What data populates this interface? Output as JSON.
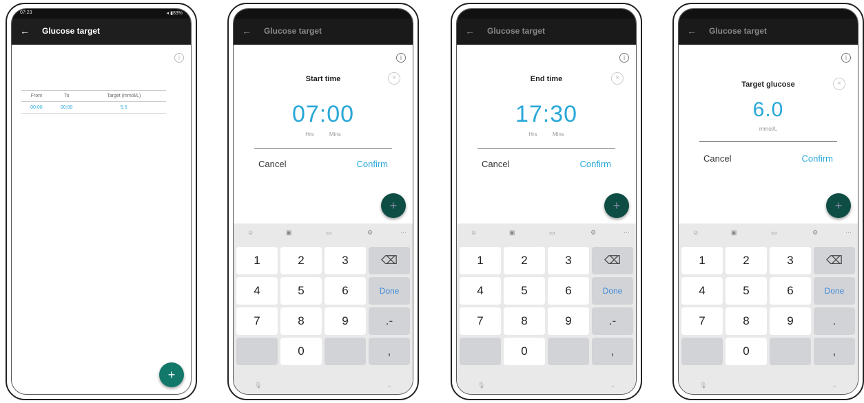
{
  "screen1": {
    "status_time": "07:23",
    "status_right": "◂ ▮83%",
    "title": "Glucose target",
    "back": "←",
    "info": "i",
    "columns": [
      "From",
      "To",
      "Target (mmol/L)"
    ],
    "rows": [
      {
        "from": "00:00",
        "to": "00:00",
        "target": "5.5"
      }
    ],
    "fab": "+"
  },
  "dialogs": [
    {
      "title": "Start time",
      "value": "07:00",
      "units": [
        "Hrs",
        "Mins"
      ],
      "cancel": "Cancel",
      "confirm": "Confirm"
    },
    {
      "title": "End time",
      "value": "17:30",
      "units": [
        "Hrs",
        "Mins"
      ],
      "cancel": "Cancel",
      "confirm": "Confirm"
    },
    {
      "title": "Target glucose",
      "value": "6.0",
      "units": [
        "mmol/L"
      ],
      "cancel": "Cancel",
      "confirm": "Confirm"
    }
  ],
  "keyboard": {
    "toolbar": [
      "☺",
      "▣",
      "▭",
      "⚙",
      "···"
    ],
    "keys_a": [
      "1",
      "2",
      "3",
      "⌫",
      "4",
      "5",
      "6",
      "Done",
      "7",
      "8",
      "9",
      ".-",
      "",
      "0",
      "",
      ","
    ],
    "keys_b": [
      "1",
      "2",
      "3",
      "⌫",
      "4",
      "5",
      "6",
      "Done",
      "7",
      "8",
      "9",
      ".",
      "",
      "0",
      "",
      ","
    ],
    "mic": "🎙",
    "hide": "⌄"
  },
  "title_dim": "Glucose target",
  "back_dim": "←",
  "info_dim": "i",
  "fab_dim": "+",
  "close_icon": "×"
}
